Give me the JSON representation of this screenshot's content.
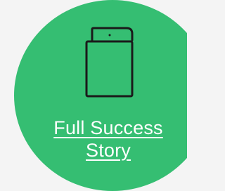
{
  "card": {
    "icon": "book-icon",
    "link_line1": "Full Success",
    "link_line2": "Story"
  },
  "colors": {
    "background": "#f4f4f4",
    "circle": "#35be72",
    "link_text": "#ffffff",
    "icon_stroke": "#1a1a1a"
  }
}
